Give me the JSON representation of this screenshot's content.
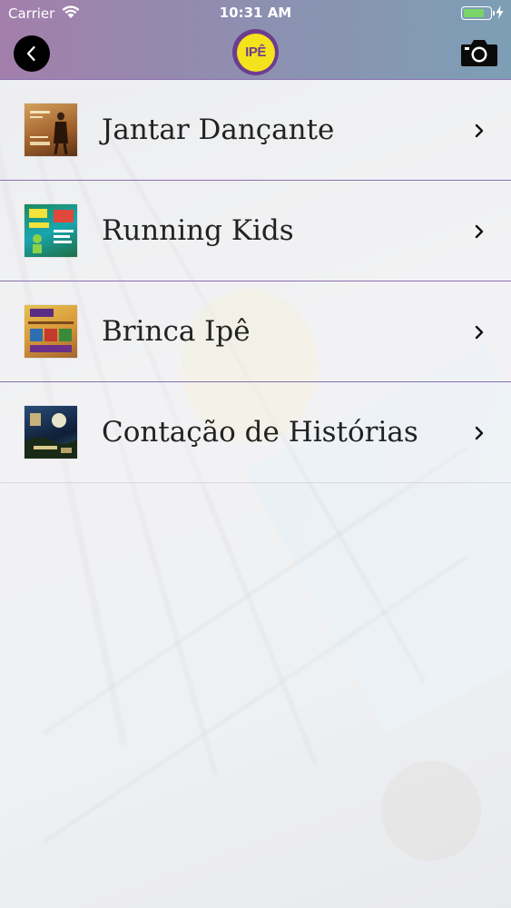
{
  "status_bar": {
    "carrier": "Carrier",
    "time": "10:31 AM",
    "battery_level": 0.8
  },
  "header": {
    "back_icon": "chevron-left-icon",
    "logo_text": "IPÊ",
    "camera_icon": "camera-icon"
  },
  "colors": {
    "header_gradient_start": "#a37fab",
    "header_gradient_end": "#7d9fb5",
    "row_divider": "#8a6fb0",
    "logo_yellow": "#f4e21c",
    "logo_purple": "#6c3d8f",
    "battery_green": "#7bd468"
  },
  "events": [
    {
      "title": "Jantar Dançante",
      "thumbnail": "dinner-dance-thumbnail",
      "icon": "chevron-right-icon"
    },
    {
      "title": "Running Kids",
      "thumbnail": "running-kids-thumbnail",
      "icon": "chevron-right-icon"
    },
    {
      "title": "Brinca Ipê",
      "thumbnail": "brinca-ipe-thumbnail",
      "icon": "chevron-right-icon"
    },
    {
      "title": "Contação de Histórias",
      "thumbnail": "storytelling-thumbnail",
      "icon": "chevron-right-icon"
    }
  ]
}
